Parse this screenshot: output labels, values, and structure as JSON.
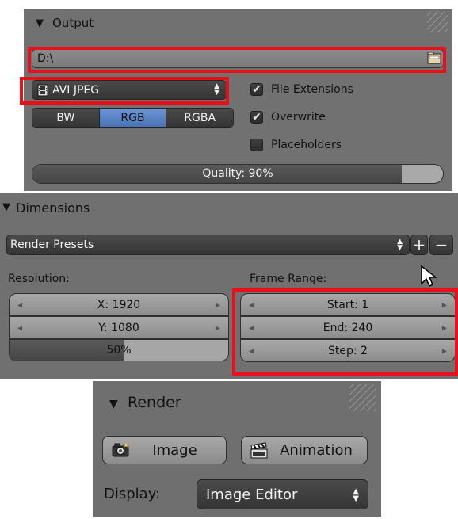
{
  "output": {
    "title": "Output",
    "path": "D:\\",
    "format": "AVI JPEG",
    "color_modes": [
      "BW",
      "RGB",
      "RGBA"
    ],
    "selected_color_mode": "RGB",
    "checkboxes": [
      {
        "label": "File Extensions",
        "checked": true
      },
      {
        "label": "Overwrite",
        "checked": true
      },
      {
        "label": "Placeholders",
        "checked": false
      }
    ],
    "quality_label": "Quality: 90%",
    "quality_value": 90
  },
  "dimensions": {
    "title": "Dimensions",
    "presets": "Render Presets",
    "resolution_label": "Resolution:",
    "res_x": "X: 1920",
    "res_y": "Y: 1080",
    "res_percent": "50%",
    "res_percent_value": 50,
    "frame_range_label": "Frame Range:",
    "start": "Start: 1",
    "end": "End: 240",
    "step": "Step: 2"
  },
  "render": {
    "title": "Render",
    "image_label": "Image",
    "animation_label": "Animation",
    "display_label": "Display:",
    "display_value": "Image Editor"
  },
  "icons": {
    "folder": "folder-icon",
    "film": "film-icon",
    "camera": "camera-icon",
    "clapper": "clapperboard-icon",
    "plus": "plus-icon",
    "minus": "minus-icon",
    "cursor": "mouse-cursor-icon"
  },
  "colors": {
    "panel_bg": "#727272",
    "selected_blue": "#5680c2",
    "highlight_red": "#e8101a"
  }
}
